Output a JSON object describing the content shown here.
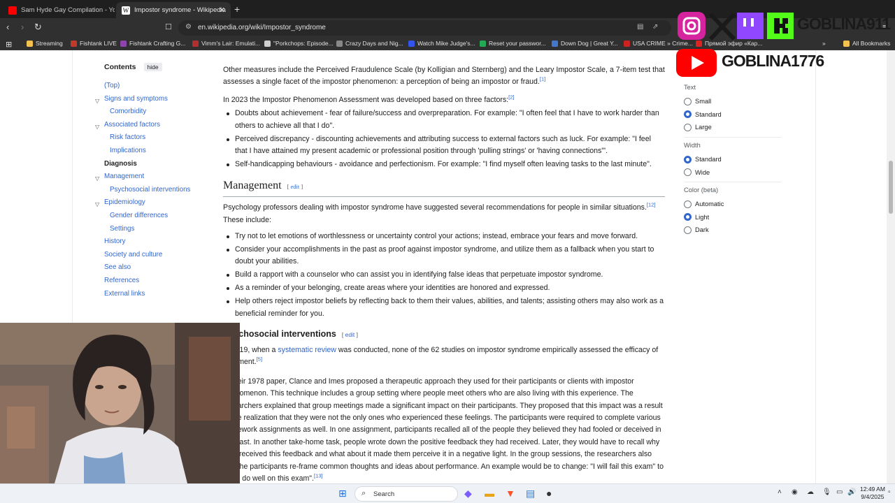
{
  "browser": {
    "tabs": [
      {
        "title": "Sam Hyde Gay Compilation - YouTube",
        "active": false,
        "favicon_color": "#ff0000"
      },
      {
        "title": "Impostor syndrome - Wikipedia",
        "active": true,
        "favicon_color": "#ffffff"
      }
    ],
    "url": "en.wikipedia.org/wiki/Impostor_syndrome",
    "bookmarks": [
      {
        "label": "Streaming",
        "icon_color": "#f2c14e"
      },
      {
        "label": "Fishtank LIVE",
        "icon_color": "#c0392b"
      },
      {
        "label": "Fishtank Crafting G...",
        "icon_color": "#8e44ad"
      },
      {
        "label": "Vimm's Lair: Emulati...",
        "icon_color": "#b03030"
      },
      {
        "label": "\"Porkchops: Episode...",
        "icon_color": "#d0d0d0"
      },
      {
        "label": "Crazy Days and Nig...",
        "icon_color": "#888888"
      },
      {
        "label": "Watch Mike Judge's...",
        "icon_color": "#3355ee"
      },
      {
        "label": "Reset your passwor...",
        "icon_color": "#22aa55"
      },
      {
        "label": "Down Dog | Great Y...",
        "icon_color": "#4477cc"
      },
      {
        "label": "USA CRIME » Crime...",
        "icon_color": "#cc2222"
      },
      {
        "label": "Прямой эфир «Кар...",
        "icon_color": "#dd2222"
      }
    ],
    "all_bookmarks_label": "All Bookmarks"
  },
  "toc": {
    "title": "Contents",
    "hide_label": "hide",
    "items": [
      {
        "label": "(Top)",
        "level": 1,
        "chevron": false
      },
      {
        "label": "Signs and symptoms",
        "level": 1,
        "chevron": true
      },
      {
        "label": "Comorbidity",
        "level": 2,
        "chevron": false
      },
      {
        "label": "Associated factors",
        "level": 1,
        "chevron": true
      },
      {
        "label": "Risk factors",
        "level": 2,
        "chevron": false
      },
      {
        "label": "Implications",
        "level": 2,
        "chevron": false
      },
      {
        "label": "Diagnosis",
        "level": 1,
        "chevron": false,
        "current": true
      },
      {
        "label": "Management",
        "level": 1,
        "chevron": true
      },
      {
        "label": "Psychosocial interventions",
        "level": 2,
        "chevron": false
      },
      {
        "label": "Epidemiology",
        "level": 1,
        "chevron": true
      },
      {
        "label": "Gender differences",
        "level": 2,
        "chevron": false
      },
      {
        "label": "Settings",
        "level": 2,
        "chevron": false
      },
      {
        "label": "History",
        "level": 1,
        "chevron": false
      },
      {
        "label": "Society and culture",
        "level": 1,
        "chevron": false
      },
      {
        "label": "See also",
        "level": 1,
        "chevron": false
      },
      {
        "label": "References",
        "level": 1,
        "chevron": false
      },
      {
        "label": "External links",
        "level": 1,
        "chevron": false
      }
    ]
  },
  "article": {
    "p1": "Other measures include the Perceived Fraudulence Scale (by Kolligian and Sternberg) and the Leary Impostor Scale, a 7-item test that assesses a single facet of the impostor phenomenon: a perception of being an impostor or fraud.",
    "p1_ref": "[1]",
    "p2": "In 2023 the Impostor Phenomenon Assessment was developed based on three factors:",
    "p2_ref": "[2]",
    "diagnosis_list": [
      "Doubts about achievement - fear of failure/success and overpreparation. For example: \"I often feel that I have to work harder than others to achieve all that I do\".",
      "Perceived discrepancy - discounting achievements and attributing success to external factors such as luck. For example: \"I feel that I have attained my present academic or professional position through 'pulling strings' or 'having connections'\".",
      "Self-handicapping behaviours - avoidance and perfectionism. For example: \"I find myself often leaving tasks to the last minute\"."
    ],
    "h_management": "Management",
    "edit_label": "edit",
    "mgmt_intro": "Psychology professors dealing with impostor syndrome have suggested several recommendations for people in similar situations.",
    "mgmt_ref": "[12]",
    "mgmt_intro2": "These include:",
    "mgmt_list": [
      "Try not to let emotions of worthlessness or uncertainty control your actions; instead, embrace your fears and move forward.",
      "Consider your accomplishments in the past as proof against impostor syndrome, and utilize them as a fallback when you start to doubt your abilities.",
      "Build a rapport with a counselor who can assist you in identifying false ideas that perpetuate impostor syndrome.",
      "As a reminder of your belonging, create areas where your identities are honored and expressed.",
      "Help others reject impostor beliefs by reflecting back to them their values, abilities, and talents; assisting others may also work as a beneficial reminder for you."
    ],
    "h_psychosocial": "Psychosocial interventions",
    "psy_p1_a": "In 2019, when a",
    "psy_p1_link": "systematic review",
    "psy_p1_b": "was conducted, none of the 62 studies on impostor syndrome empirically assessed the efficacy of treatment.",
    "psy_p1_ref": "[5]",
    "psy_p2": "In their 1978 paper, Clance and Imes proposed a therapeutic approach they used for their participants or clients with impostor phenomenon. This technique includes a group setting where people meet others who are also living with this experience. The researchers explained that group meetings made a significant impact on their participants. They proposed that this impact was a result of the realization that they were not the only ones who experienced these feelings. The participants were required to complete various homework assignments as well. In one assignment, participants recalled all of the people they believed they had fooled or deceived in the past. In another take-home task, people wrote down the positive feedback they had received. Later, they would have to recall why they received this feedback and what about it made them perceive it in a negative light. In the group sessions, the researchers also had the participants re-frame common thoughts and ideas about performance. An example would be to change: \"I will fail this exam\" to \"I will do well on this exam\".",
    "psy_p2_ref": "[13]"
  },
  "appearance": {
    "text_label": "Text",
    "text_options": [
      {
        "label": "Small",
        "selected": false
      },
      {
        "label": "Standard",
        "selected": true
      },
      {
        "label": "Large",
        "selected": false
      }
    ],
    "width_label": "Width",
    "width_options": [
      {
        "label": "Standard",
        "selected": true
      },
      {
        "label": "Wide",
        "selected": false
      }
    ],
    "color_label": "Color (beta)",
    "color_options": [
      {
        "label": "Automatic",
        "selected": false
      },
      {
        "label": "Light",
        "selected": true
      },
      {
        "label": "Dark",
        "selected": false
      }
    ]
  },
  "overlay": {
    "handle1": "GOBLINA911",
    "handle2": "GOBLINA1776"
  },
  "taskbar": {
    "search_label": "Search",
    "time": "12:49 AM",
    "date": "9/4/2025"
  }
}
